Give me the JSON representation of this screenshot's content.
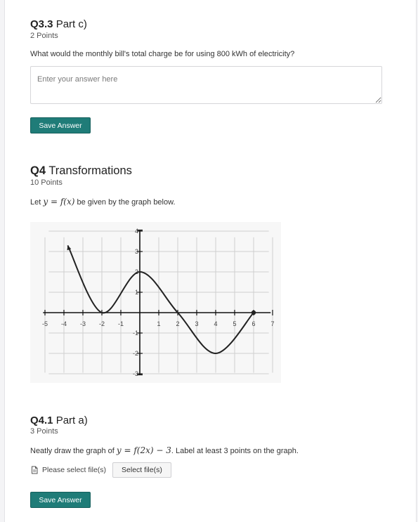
{
  "q3_3": {
    "number": "Q3.3",
    "title": "Part c)",
    "points": "2 Points",
    "prompt": "What would the monthly bill's total charge be for using 800 kWh of electricity?",
    "answer_placeholder": "Enter your answer here",
    "answer_value": "",
    "save_label": "Save Answer"
  },
  "q4": {
    "number": "Q4",
    "title": "Transformations",
    "points": "10 Points",
    "prompt_before": "Let ",
    "prompt_math": "y = f(x)",
    "prompt_after": " be given by the graph below."
  },
  "q4_1": {
    "number": "Q4.1",
    "title": "Part a)",
    "points": "3 Points",
    "prompt_before": "Neatly draw the graph of ",
    "prompt_math": "y = f(2x) − 3",
    "prompt_after": ". Label at least 3 points on the graph.",
    "file_label": "Please select file(s)",
    "file_button": "Select file(s)",
    "save_label": "Save Answer"
  },
  "graph": {
    "x_ticks": [
      "-5",
      "-4",
      "-3",
      "-2",
      "-1",
      "1",
      "2",
      "3",
      "4",
      "5",
      "6",
      "7"
    ],
    "y_ticks": [
      "4",
      "3",
      "2",
      "1",
      "-1",
      "-2",
      "-3"
    ],
    "x_range": [
      -5,
      7
    ],
    "y_range": [
      -3,
      4
    ],
    "grid": true,
    "curve_points": [
      {
        "x": -3.8,
        "y": 3.3
      },
      {
        "x": -2,
        "y": 0
      },
      {
        "x": 0,
        "y": 2
      },
      {
        "x": 2,
        "y": 0
      },
      {
        "x": 4,
        "y": -2
      },
      {
        "x": 6,
        "y": 0
      }
    ],
    "curve_color": "#222222"
  },
  "colors": {
    "accent": "#1f7c78",
    "page_bg": "#f4f4f6"
  }
}
